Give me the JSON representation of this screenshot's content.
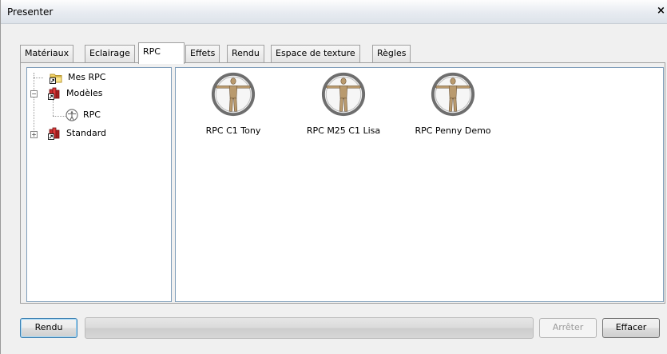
{
  "window": {
    "title": "Presenter",
    "close_label": "×"
  },
  "tabs": [
    {
      "label": "Matériaux"
    },
    {
      "label": "Eclairage"
    },
    {
      "label": "RPC"
    },
    {
      "label": "Effets"
    },
    {
      "label": "Rendu"
    },
    {
      "label": "Espace de texture"
    },
    {
      "label": "Règles"
    }
  ],
  "active_tab": "RPC",
  "tree": {
    "items": [
      {
        "label": "Mes RPC",
        "icon": "folder-icon"
      },
      {
        "label": "Modèles",
        "icon": "books-icon",
        "expander": "−"
      },
      {
        "label": "RPC",
        "icon": "person-icon"
      },
      {
        "label": "Standard",
        "icon": "books-icon",
        "expander": "+"
      }
    ]
  },
  "content": {
    "items": [
      {
        "label": "RPC C1 Tony",
        "icon": "vitruvian-man-icon"
      },
      {
        "label": "RPC M25 C1 Lisa",
        "icon": "vitruvian-man-icon"
      },
      {
        "label": "RPC Penny Demo",
        "icon": "vitruvian-man-icon"
      }
    ]
  },
  "footer": {
    "render_label": "Rendu",
    "stop_label": "Arrêter",
    "clear_label": "Effacer",
    "progress": 0
  },
  "colors": {
    "pane_border": "#7f9db9",
    "primary_border": "#3c7fb1"
  }
}
